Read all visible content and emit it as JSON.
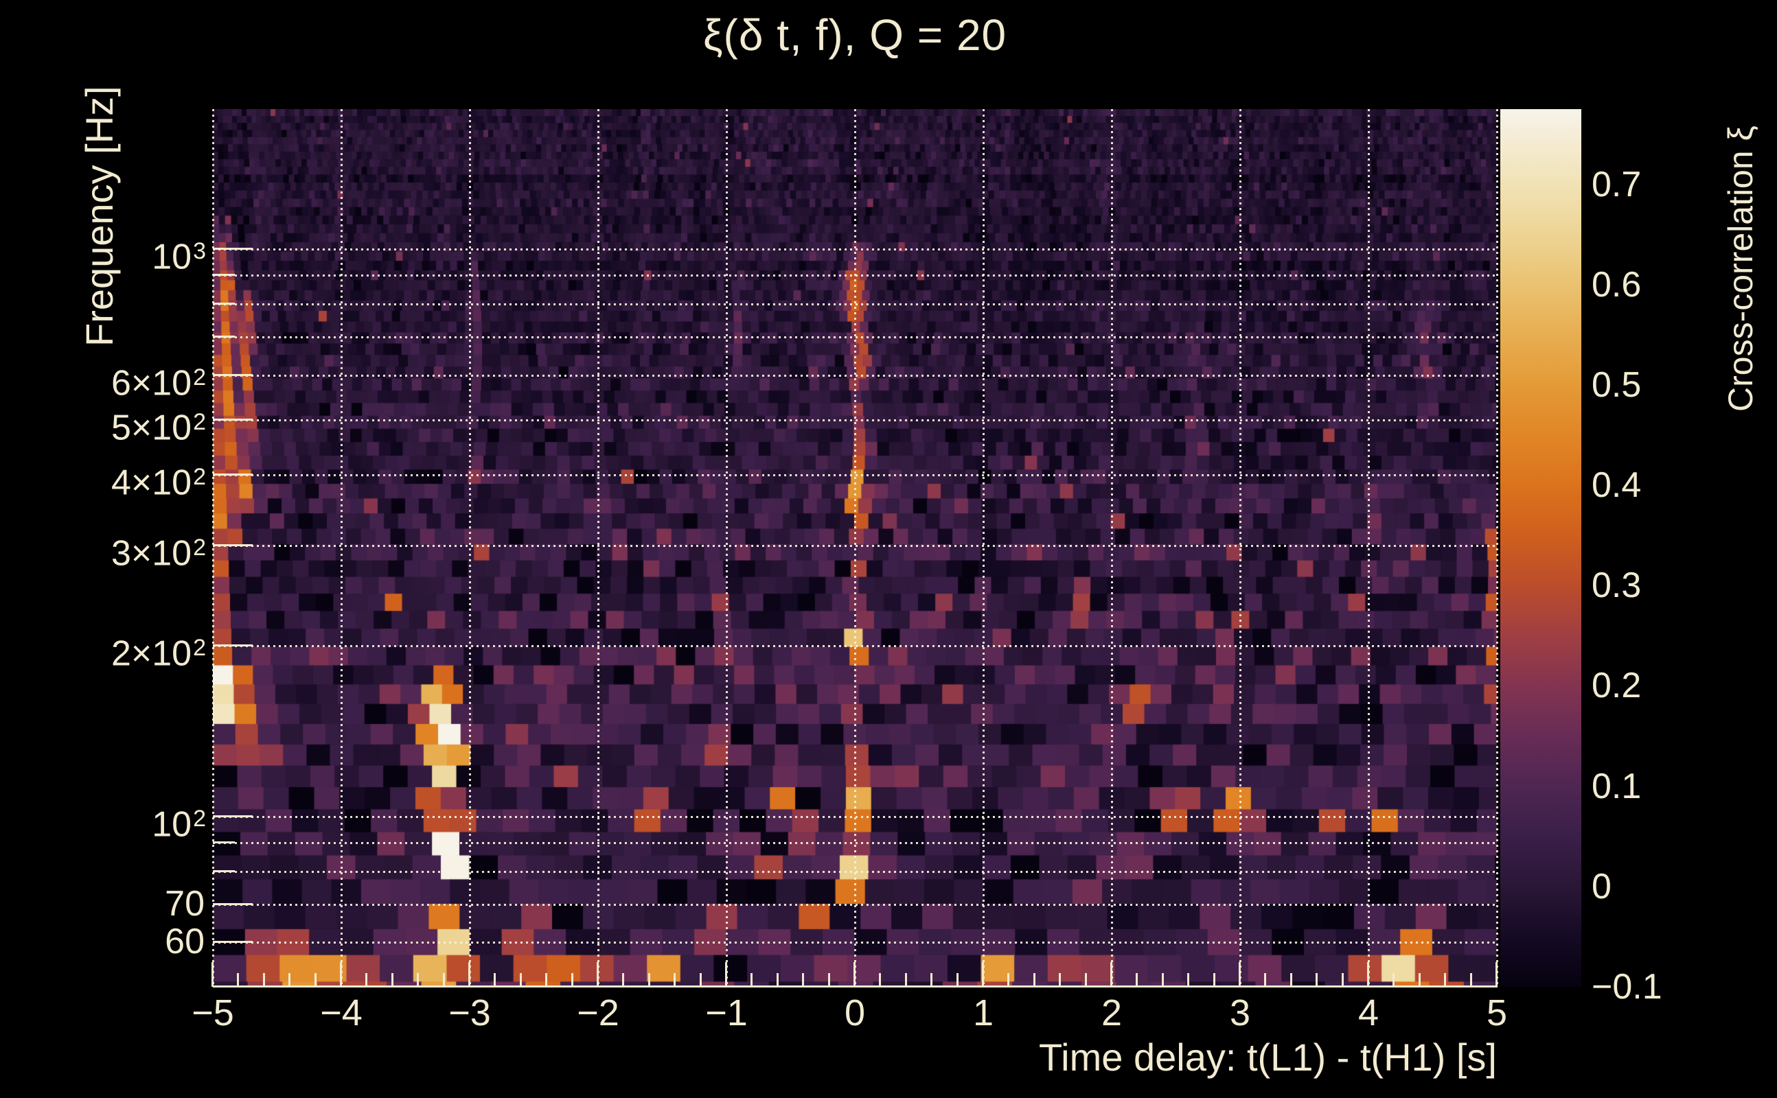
{
  "figure_title": "ξ(δ t, f), Q = 20",
  "text_color": "#f2ebd0",
  "background_color": "#000000",
  "x_axis": {
    "title": "Time delay: t(L1) - t(H1) [s]",
    "range_s": [
      -5,
      5
    ],
    "major_ticks": [
      {
        "value": -5,
        "label": "−5"
      },
      {
        "value": -4,
        "label": "−4"
      },
      {
        "value": -3,
        "label": "−3"
      },
      {
        "value": -2,
        "label": "−2"
      },
      {
        "value": -1,
        "label": "−1"
      },
      {
        "value": 0,
        "label": "0"
      },
      {
        "value": 1,
        "label": "1"
      },
      {
        "value": 2,
        "label": "2"
      },
      {
        "value": 3,
        "label": "3"
      },
      {
        "value": 4,
        "label": "4"
      },
      {
        "value": 5,
        "label": "5"
      }
    ],
    "minor_tick_step": 0.2
  },
  "y_axis": {
    "title": "Frequency [Hz]",
    "scale": "log",
    "range_hz": [
      50.1,
      1766
    ],
    "labeled_ticks": [
      {
        "value": 1000,
        "mantissa": "10",
        "exponent": "3"
      },
      {
        "value": 600,
        "mantissa": "6×10",
        "exponent": "2"
      },
      {
        "value": 500,
        "mantissa": "5×10",
        "exponent": "2"
      },
      {
        "value": 400,
        "mantissa": "4×10",
        "exponent": "2"
      },
      {
        "value": 300,
        "mantissa": "3×10",
        "exponent": "2"
      },
      {
        "value": 200,
        "mantissa": "2×10",
        "exponent": "2"
      },
      {
        "value": 100,
        "mantissa": "10",
        "exponent": "2"
      },
      {
        "value": 70,
        "mantissa": "70",
        "exponent": ""
      },
      {
        "value": 60,
        "mantissa": "60",
        "exponent": ""
      }
    ],
    "unlabeled_ticks": [
      900,
      800,
      700,
      90,
      80
    ],
    "gridlines_hz": [
      1000,
      900,
      800,
      700,
      600,
      500,
      400,
      300,
      200,
      100,
      90,
      80,
      70,
      60
    ]
  },
  "colorbar": {
    "title": "Cross-correlation ξ",
    "range": [
      -0.1,
      0.775
    ],
    "ticks": [
      {
        "value": 0.7,
        "label": "0.7"
      },
      {
        "value": 0.6,
        "label": "0.6"
      },
      {
        "value": 0.5,
        "label": "0.5"
      },
      {
        "value": 0.4,
        "label": "0.4"
      },
      {
        "value": 0.3,
        "label": "0.3"
      },
      {
        "value": 0.2,
        "label": "0.2"
      },
      {
        "value": 0.1,
        "label": "0.1"
      },
      {
        "value": 0,
        "label": "0"
      },
      {
        "value": -0.1,
        "label": "−0.1"
      }
    ]
  },
  "chart_data": {
    "type": "heatmap",
    "title": "ξ(δ t, f), Q = 20",
    "xlabel": "Time delay: t(L1) - t(H1) [s]",
    "ylabel": "Frequency [Hz]",
    "value_label": "Cross-correlation ξ",
    "x_range_s": [
      -5,
      5
    ],
    "y_range_hz": [
      50.1,
      1766
    ],
    "y_scale": "log",
    "value_range": [
      -0.1,
      0.775
    ],
    "grid_on": true,
    "palette": [
      [
        -0.1,
        "#060210"
      ],
      [
        -0.05,
        "#150a24"
      ],
      [
        0.0,
        "#2a1636"
      ],
      [
        0.05,
        "#3a1f48"
      ],
      [
        0.1,
        "#4f2652"
      ],
      [
        0.15,
        "#672c56"
      ],
      [
        0.2,
        "#833450"
      ],
      [
        0.25,
        "#a03f43"
      ],
      [
        0.3,
        "#bb4d2c"
      ],
      [
        0.35,
        "#cf5f1d"
      ],
      [
        0.4,
        "#db731d"
      ],
      [
        0.45,
        "#e18627"
      ],
      [
        0.5,
        "#e49a37"
      ],
      [
        0.55,
        "#e7ae51"
      ],
      [
        0.6,
        "#eac271"
      ],
      [
        0.65,
        "#edd494"
      ],
      [
        0.7,
        "#f1e2b5"
      ],
      [
        0.775,
        "#f7f3e9"
      ]
    ],
    "noise_bands": [
      {
        "f_lo": 700,
        "f_hi": 1800,
        "mean": -0.015,
        "std": 0.03,
        "spike_p": 0.01,
        "spike": 0.16
      },
      {
        "f_lo": 400,
        "f_hi": 700,
        "mean": -0.005,
        "std": 0.038,
        "spike_p": 0.014,
        "spike": 0.15
      },
      {
        "f_lo": 250,
        "f_hi": 400,
        "mean": 0.01,
        "std": 0.055,
        "spike_p": 0.03,
        "spike": 0.15
      },
      {
        "f_lo": 140,
        "f_hi": 250,
        "mean": 0.028,
        "std": 0.066,
        "spike_p": 0.05,
        "spike": 0.14
      },
      {
        "f_lo": 95,
        "f_hi": 140,
        "mean": 0.03,
        "std": 0.072,
        "spike_p": 0.06,
        "spike": 0.15
      },
      {
        "f_lo": 50,
        "f_hi": 95,
        "mean": 0.02,
        "std": 0.062,
        "spike_p": 0.05,
        "spike": 0.14
      }
    ],
    "texture": {
      "seed": 42,
      "stripe_amp": 0.022,
      "row_jitter": 0.012
    },
    "features": [
      {
        "t": -4.93,
        "f_lo": 150,
        "f_hi": 1050,
        "xi": 0.3,
        "sigma_t": 0.05
      },
      {
        "t": -4.87,
        "f_lo": 300,
        "f_hi": 900,
        "xi": 0.22,
        "sigma_t": 0.04
      },
      {
        "t": -4.74,
        "f_lo": 350,
        "f_hi": 820,
        "xi": 0.36,
        "sigma_t": 0.035
      },
      {
        "t": -4.85,
        "f_lo": 155,
        "f_hi": 185,
        "xi": 0.5,
        "sigma_t": 0.1
      },
      {
        "t": -4.82,
        "f_lo": 125,
        "f_hi": 155,
        "xi": 0.28,
        "sigma_t": 0.09
      },
      {
        "t": -4.6,
        "f_lo": 50,
        "f_hi": 60,
        "xi": 0.28,
        "sigma_t": 0.1
      },
      {
        "t": -4.32,
        "f_lo": 50,
        "f_hi": 58,
        "xi": 0.42,
        "sigma_t": 0.09
      },
      {
        "t": -4.05,
        "f_lo": 50,
        "f_hi": 56,
        "xi": 0.38,
        "sigma_t": 0.07
      },
      {
        "t": -3.85,
        "f_lo": 50,
        "f_hi": 54,
        "xi": 0.28,
        "sigma_t": 0.08
      },
      {
        "t": -3.12,
        "f_lo": 52,
        "f_hi": 165,
        "xi": 0.52,
        "sigma_t": 0.055,
        "tilt": -0.25
      },
      {
        "t": -3.12,
        "f_lo": 84,
        "f_hi": 96,
        "xi": 0.7,
        "sigma_t": 0.05
      },
      {
        "t": -3.14,
        "f_lo": 126,
        "f_hi": 150,
        "xi": 0.65,
        "sigma_t": 0.05
      },
      {
        "t": -3.3,
        "f_lo": 100,
        "f_hi": 168,
        "xi": 0.26,
        "sigma_t": 0.08
      },
      {
        "t": -3.28,
        "f_lo": 50,
        "f_hi": 57,
        "xi": 0.45,
        "sigma_t": 0.13
      },
      {
        "t": -3.2,
        "f_lo": 165,
        "f_hi": 182,
        "xi": 0.38,
        "sigma_t": 0.05
      },
      {
        "t": -2.95,
        "f_lo": 400,
        "f_hi": 950,
        "xi": 0.12,
        "sigma_t": 0.03
      },
      {
        "t": -2.9,
        "f_lo": 280,
        "f_hi": 320,
        "xi": 0.22,
        "sigma_t": 0.06
      },
      {
        "t": -2.55,
        "f_lo": 50,
        "f_hi": 60,
        "xi": 0.4,
        "sigma_t": 0.12
      },
      {
        "t": -2.28,
        "f_lo": 50,
        "f_hi": 56,
        "xi": 0.34,
        "sigma_t": 0.08
      },
      {
        "t": -2.05,
        "f_lo": 50,
        "f_hi": 54,
        "xi": 0.28,
        "sigma_t": 0.06
      },
      {
        "t": -1.85,
        "f_lo": 285,
        "f_hi": 315,
        "xi": 0.2,
        "sigma_t": 0.05
      },
      {
        "t": -1.59,
        "f_lo": 95,
        "f_hi": 112,
        "xi": 0.34,
        "sigma_t": 0.05
      },
      {
        "t": -1.51,
        "f_lo": 50,
        "f_hi": 54,
        "xi": 0.42,
        "sigma_t": 0.06
      },
      {
        "t": -1.1,
        "f_lo": 62,
        "f_hi": 70,
        "xi": 0.45,
        "sigma_t": 0.06
      },
      {
        "t": -0.9,
        "f_lo": 600,
        "f_hi": 900,
        "xi": 0.1,
        "sigma_t": 0.03
      },
      {
        "t": -0.52,
        "f_lo": 95,
        "f_hi": 116,
        "xi": 0.36,
        "sigma_t": 0.06
      },
      {
        "t": -0.36,
        "f_lo": 88,
        "f_hi": 100,
        "xi": 0.28,
        "sigma_t": 0.05
      },
      {
        "t": 0.02,
        "f_lo": 52,
        "f_hi": 1000,
        "xi": 0.16,
        "sigma_t": 0.05
      },
      {
        "t": 0.02,
        "f_lo": 70,
        "f_hi": 83,
        "xi": 0.52,
        "sigma_t": 0.05
      },
      {
        "t": 0.02,
        "f_lo": 100,
        "f_hi": 113,
        "xi": 0.42,
        "sigma_t": 0.04
      },
      {
        "t": 0.0,
        "f_lo": 198,
        "f_hi": 228,
        "xi": 0.48,
        "sigma_t": 0.05
      },
      {
        "t": 0.02,
        "f_lo": 335,
        "f_hi": 400,
        "xi": 0.36,
        "sigma_t": 0.04
      },
      {
        "t": 0.06,
        "f_lo": 615,
        "f_hi": 700,
        "xi": 0.22,
        "sigma_t": 0.06
      },
      {
        "t": -0.02,
        "f_lo": 770,
        "f_hi": 905,
        "xi": 0.26,
        "sigma_t": 0.07
      },
      {
        "t": 0.1,
        "f_lo": 430,
        "f_hi": 470,
        "xi": 0.18,
        "sigma_t": 0.04
      },
      {
        "t": 0.55,
        "f_lo": 95,
        "f_hi": 106,
        "xi": 0.24,
        "sigma_t": 0.04
      },
      {
        "t": 0.95,
        "f_lo": 50,
        "f_hi": 54,
        "xi": 0.28,
        "sigma_t": 0.06
      },
      {
        "t": 1.1,
        "f_lo": 50,
        "f_hi": 58,
        "xi": 0.42,
        "sigma_t": 0.1
      },
      {
        "t": 1.35,
        "f_lo": 95,
        "f_hi": 106,
        "xi": 0.3,
        "sigma_t": 0.05
      },
      {
        "t": 1.4,
        "f_lo": 250,
        "f_hi": 500,
        "xi": 0.1,
        "sigma_t": 0.03
      },
      {
        "t": 1.75,
        "f_lo": 238,
        "f_hi": 262,
        "xi": 0.22,
        "sigma_t": 0.05
      },
      {
        "t": 1.8,
        "f_lo": 50,
        "f_hi": 55,
        "xi": 0.28,
        "sigma_t": 0.1
      },
      {
        "t": 2.2,
        "f_lo": 148,
        "f_hi": 166,
        "xi": 0.24,
        "sigma_t": 0.05
      },
      {
        "t": 2.3,
        "f_lo": 50,
        "f_hi": 54,
        "xi": 0.26,
        "sigma_t": 0.08
      },
      {
        "t": 2.5,
        "f_lo": 95,
        "f_hi": 105,
        "xi": 0.22,
        "sigma_t": 0.04
      },
      {
        "t": 2.65,
        "f_lo": 300,
        "f_hi": 700,
        "xi": 0.1,
        "sigma_t": 0.03
      },
      {
        "t": 2.95,
        "f_lo": 100,
        "f_hi": 116,
        "xi": 0.34,
        "sigma_t": 0.07
      },
      {
        "t": 3.1,
        "f_lo": 95,
        "f_hi": 105,
        "xi": 0.24,
        "sigma_t": 0.04
      },
      {
        "t": 3.3,
        "f_lo": 50,
        "f_hi": 55,
        "xi": 0.28,
        "sigma_t": 0.08
      },
      {
        "t": 3.65,
        "f_lo": 95,
        "f_hi": 108,
        "xi": 0.36,
        "sigma_t": 0.07
      },
      {
        "t": 4.1,
        "f_lo": 95,
        "f_hi": 105,
        "xi": 0.28,
        "sigma_t": 0.05
      },
      {
        "t": 4.25,
        "f_lo": 50,
        "f_hi": 57,
        "xi": 0.5,
        "sigma_t": 0.14
      },
      {
        "t": 4.42,
        "f_lo": 57,
        "f_hi": 67,
        "xi": 0.34,
        "sigma_t": 0.07
      },
      {
        "t": 4.45,
        "f_lo": 500,
        "f_hi": 800,
        "xi": 0.12,
        "sigma_t": 0.04
      },
      {
        "t": 4.6,
        "f_lo": 50,
        "f_hi": 54,
        "xi": 0.28,
        "sigma_t": 0.07
      },
      {
        "t": 4.97,
        "f_lo": 140,
        "f_hi": 320,
        "xi": 0.28,
        "sigma_t": 0.04
      }
    ]
  }
}
